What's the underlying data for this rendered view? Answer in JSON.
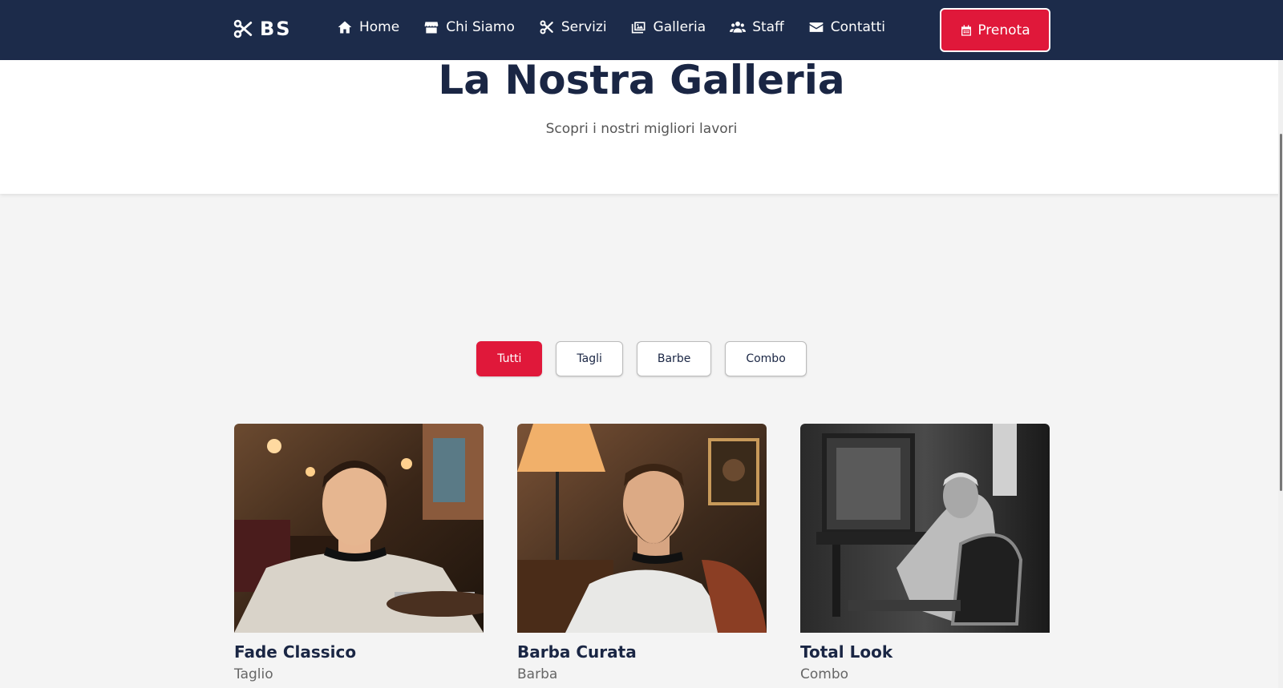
{
  "brand": {
    "name": "BS",
    "icon": "scissors-icon"
  },
  "nav": [
    {
      "label": "Home",
      "icon": "home-icon"
    },
    {
      "label": "Chi Siamo",
      "icon": "store-icon"
    },
    {
      "label": "Servizi",
      "icon": "scissors-icon"
    },
    {
      "label": "Galleria",
      "icon": "images-icon"
    },
    {
      "label": "Staff",
      "icon": "users-icon"
    },
    {
      "label": "Contatti",
      "icon": "envelope-icon"
    }
  ],
  "cta": {
    "label": "Prenota",
    "icon": "calendar-icon"
  },
  "hero": {
    "title": "La Nostra Galleria",
    "subtitle": "Scopri i nostri migliori lavori"
  },
  "filters": [
    {
      "label": "Tutti",
      "active": true
    },
    {
      "label": "Tagli",
      "active": false
    },
    {
      "label": "Barbe",
      "active": false
    },
    {
      "label": "Combo",
      "active": false
    }
  ],
  "gallery": [
    {
      "title": "Fade Classico",
      "category": "Taglio"
    },
    {
      "title": "Barba Curata",
      "category": "Barba"
    },
    {
      "title": "Total Look",
      "category": "Combo"
    }
  ],
  "colors": {
    "navy": "#1c2b4a",
    "accent": "#e0183a",
    "background": "#f4f4f4"
  }
}
